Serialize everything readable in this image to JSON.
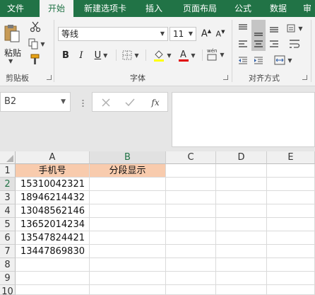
{
  "tabs": [
    {
      "label": "文件",
      "active": false
    },
    {
      "label": "开始",
      "active": true
    },
    {
      "label": "新建选项卡",
      "active": false
    },
    {
      "label": "插入",
      "active": false
    },
    {
      "label": "页面布局",
      "active": false
    },
    {
      "label": "公式",
      "active": false
    },
    {
      "label": "数据",
      "active": false
    },
    {
      "label": "审",
      "active": false
    }
  ],
  "ribbon": {
    "clipboard": {
      "paste_label": "粘贴",
      "group_label": "剪贴板"
    },
    "font": {
      "font_name": "等线",
      "font_size": "11",
      "group_label": "字体"
    },
    "alignment": {
      "group_label": "对齐方式"
    }
  },
  "name_box": {
    "value": "B2"
  },
  "formula_bar": {
    "fx_label": "fx",
    "value": ""
  },
  "columns": [
    "A",
    "B",
    "C",
    "D",
    "E"
  ],
  "rows": [
    "1",
    "2",
    "3",
    "4",
    "5",
    "6",
    "7",
    "8",
    "9",
    "10"
  ],
  "cells": {
    "A1": "手机号",
    "B1": "分段显示",
    "A2": "15310042321",
    "A3": "18946214432",
    "A4": "13048562146",
    "A5": "13652014234",
    "A6": "13547824421",
    "A7": "13447869830"
  },
  "colors": {
    "brand": "#217346",
    "header_fill": "#f8cbad"
  }
}
